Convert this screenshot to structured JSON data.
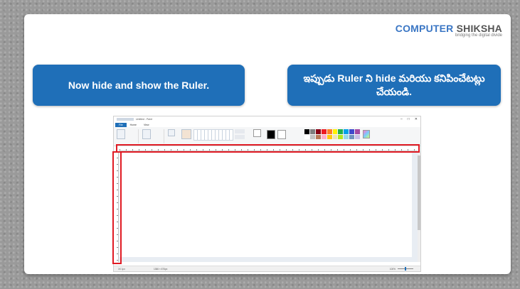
{
  "logo": {
    "brand_part1": "COMPUTER",
    "brand_part2": " SHIKSHA",
    "tagline": "bridging the digital divide"
  },
  "instructions": {
    "english": "Now hide and show the Ruler.",
    "telugu": "ఇప్పుడు Ruler ని hide మరియు కనిపించేటట్లు చేయండి."
  },
  "paint_window": {
    "title": "Untitled - Paint",
    "window_controls": [
      "–",
      "□",
      "✕"
    ],
    "tabs": [
      "File",
      "Home",
      "View"
    ],
    "status_left": "1K 1px",
    "status_mid": "1366 × 676px",
    "zoom": "100%"
  },
  "colors": {
    "banner": "#1f6fb8",
    "highlight": "#e01b24",
    "palette": [
      "#000000",
      "#7f7f7f",
      "#880015",
      "#ed1c24",
      "#ff7f27",
      "#fff200",
      "#22b14c",
      "#00a2e8",
      "#3f48cc",
      "#a349a4",
      "#ffffff",
      "#c3c3c3",
      "#b97a57",
      "#ffaec9",
      "#ffc90e",
      "#efe4b0",
      "#b5e61d",
      "#99d9ea",
      "#7092be",
      "#c8bfe7"
    ]
  }
}
